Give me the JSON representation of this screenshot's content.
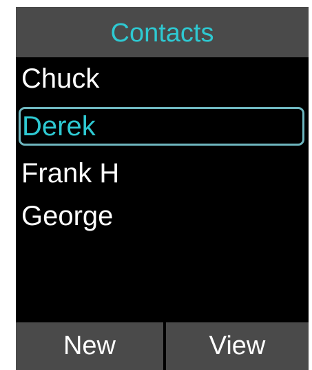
{
  "header": {
    "title": "Contacts"
  },
  "contacts": {
    "items": [
      {
        "label": "Chuck"
      },
      {
        "label": "Derek"
      },
      {
        "label": "Frank H"
      },
      {
        "label": "George"
      }
    ],
    "selected_label": "Derek"
  },
  "softkeys": {
    "left_label": "New",
    "right_label": "View"
  },
  "colors": {
    "accent": "#2ec9d2",
    "selection_border": "#6fb7c0",
    "bar_background": "#4a4a4a",
    "screen_background": "#000000",
    "text": "#ffffff"
  }
}
